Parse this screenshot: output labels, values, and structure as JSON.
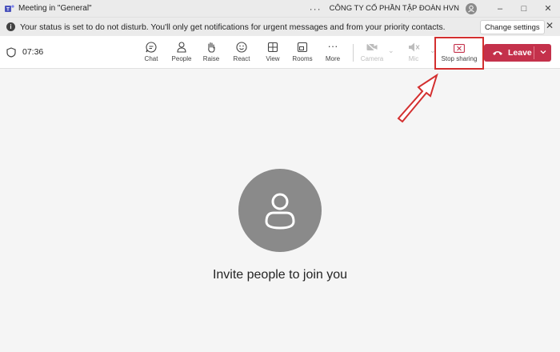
{
  "titlebar": {
    "title": "Meeting in \"General\"",
    "more_label": "···",
    "org_name": "CÔNG TY CỔ PHẦN TẬP ĐOÀN HVN",
    "minimize": "–",
    "maximize": "□",
    "close": "✕"
  },
  "notification": {
    "text": "Your status is set to do not disturb. You'll only get notifications for urgent messages and from your priority contacts.",
    "change_settings": "Change settings",
    "close": "✕",
    "info_glyph": "i"
  },
  "toolbar": {
    "timer": "07:36",
    "items": [
      {
        "label": "Chat",
        "icon": "chat-icon"
      },
      {
        "label": "People",
        "icon": "people-icon"
      },
      {
        "label": "Raise",
        "icon": "raise-hand-icon"
      },
      {
        "label": "React",
        "icon": "react-icon"
      },
      {
        "label": "View",
        "icon": "view-icon"
      },
      {
        "label": "Rooms",
        "icon": "rooms-icon"
      },
      {
        "label": "More",
        "icon": "more-icon"
      }
    ],
    "camera_label": "Camera",
    "mic_label": "Mic",
    "stop_sharing_label": "Stop sharing",
    "leave_label": "Leave",
    "more_glyph": "···",
    "chevron_glyph": "⌄"
  },
  "stage": {
    "invite_text": "Invite people to join you"
  },
  "colors": {
    "leave_bg": "#c4314b",
    "highlight": "#d32f2f",
    "avatar_bg": "#8a8a8a"
  }
}
